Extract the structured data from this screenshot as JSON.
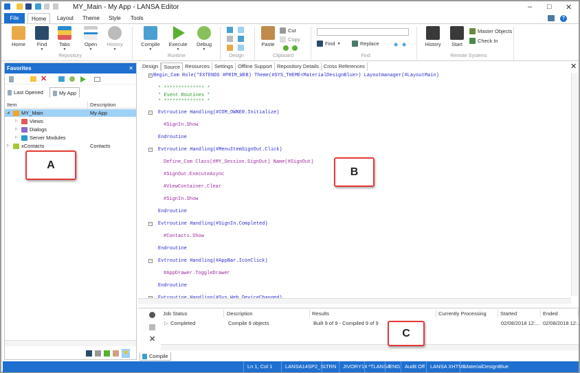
{
  "window": {
    "title": "MY_Main - My App - LANSA Editor",
    "controls": [
      "minimize",
      "maximize",
      "close"
    ]
  },
  "menu": {
    "file": "File",
    "tabs": [
      "Home",
      "Layout",
      "Theme",
      "Style",
      "Tools"
    ]
  },
  "ribbon": {
    "repository": {
      "label": "Repository",
      "buttons": [
        "Home",
        "Find",
        "Tabs",
        "Open",
        "History"
      ]
    },
    "runtime": {
      "label": "Runtime",
      "buttons": [
        "Compile",
        "Execute",
        "Debug"
      ]
    },
    "design": {
      "label": "Design"
    },
    "clipboard": {
      "label": "Clipboard",
      "paste": "Paste",
      "cut": "Cut",
      "copy": "Copy"
    },
    "find": {
      "label": "Find",
      "find": "Find",
      "replace": "Replace",
      "input_value": ""
    },
    "remote": {
      "label": "Remote Systems",
      "history": "History",
      "start": "Start",
      "master": "Master Objects",
      "checkin": "Check In"
    }
  },
  "favorites": {
    "title": "Favorites",
    "tabs": [
      "Last Opened",
      "My App"
    ],
    "columns": [
      "Item",
      "Description"
    ],
    "rows": [
      {
        "item": "MY_Main",
        "desc": "My App",
        "level": 0,
        "selected": true,
        "expanded": true,
        "color": "#f5a623"
      },
      {
        "item": "Views",
        "desc": "",
        "level": 1,
        "color": "#e05a5a"
      },
      {
        "item": "Dialogs",
        "desc": "",
        "level": 1,
        "color": "#8a6ad0"
      },
      {
        "item": "Server Modules",
        "desc": "",
        "level": 1,
        "color": "#2a9ad0"
      },
      {
        "item": "xContacts",
        "desc": "Contacts",
        "level": 0,
        "color": "#a5c83a"
      }
    ]
  },
  "editor": {
    "tabs": [
      "Design",
      "Source",
      "Resources",
      "Settings",
      "Offline Support",
      "Repository Details",
      "Cross References"
    ],
    "active_tab": "Source",
    "lines": [
      {
        "t": "Begin_Com Role(*EXTENDS #PRIM_WEB) Theme(#SYS_THEME<MaterialDesignBlue>) Layoutmanager(#LayoutMain)",
        "k": "com",
        "lv": 0,
        "exp": "+"
      },
      {
        "t": "* ************** *",
        "k": "cmt",
        "lv": 1
      },
      {
        "t": "* Event Routines *",
        "k": "cmt",
        "lv": 1
      },
      {
        "t": "* ************** *",
        "k": "cmt",
        "lv": 1
      },
      {
        "t": "Evtroutine Handling(#COM_OWNER.Initialize)",
        "k": "kw",
        "lv": 1,
        "exp": "-"
      },
      {
        "t": "#SignIn.Show",
        "k": "st",
        "lv": 2
      },
      {
        "t": "Endroutine",
        "k": "kw",
        "lv": 1
      },
      {
        "t": "Evtroutine Handling(#MenuItemSignOut.Click)",
        "k": "kw",
        "lv": 1,
        "exp": "-"
      },
      {
        "t": "Define_Com Class(#MY_Session.SignOut) Name(#SignOut)",
        "k": "st",
        "lv": 2
      },
      {
        "t": "#SignOut.ExecuteAsync",
        "k": "st",
        "lv": 2
      },
      {
        "t": "#ViewContainer.Clear",
        "k": "st",
        "lv": 2
      },
      {
        "t": "#SignIn.Show",
        "k": "st",
        "lv": 2
      },
      {
        "t": "Endroutine",
        "k": "kw",
        "lv": 1
      },
      {
        "t": "Evtroutine Handling(#SignIn.Completed)",
        "k": "kw",
        "lv": 1,
        "exp": "-"
      },
      {
        "t": "#Contacts.Show",
        "k": "st",
        "lv": 2
      },
      {
        "t": "Endroutine",
        "k": "kw",
        "lv": 1
      },
      {
        "t": "Evtroutine Handling(#AppBar.IconClick)",
        "k": "kw",
        "lv": 1,
        "exp": "-"
      },
      {
        "t": "#AppDrawer.ToggleDrawer",
        "k": "st",
        "lv": 2
      },
      {
        "t": "Endroutine",
        "k": "kw",
        "lv": 1
      },
      {
        "t": "Evtroutine Handling(#Sys_Web.DeviceChanged)",
        "k": "kw",
        "lv": 1,
        "exp": "-"
      }
    ]
  },
  "output": {
    "columns": [
      "Job Status",
      "Description",
      "Results",
      "Currently Processing",
      "Started",
      "Ended"
    ],
    "row": {
      "status": "Completed",
      "description": "Compile 9 objects",
      "results": "Built 9 of 9 - Compiled 9 of 9",
      "processing": "",
      "started": "02/08/2018 12:...",
      "ended": "02/08/2018 12:..."
    },
    "tab": "Compile"
  },
  "status": [
    "Ln 1, Col 1",
    "LANSA14SP2_SL",
    "TRN",
    "JIVORY14",
    "*TLANSA",
    "ENG",
    "Audit Off",
    "LANSA XHTML",
    "MaterialDesignBlue"
  ],
  "callouts": {
    "a": "A",
    "b": "B",
    "c": "C"
  },
  "colors": {
    "accent": "#1e6fd0",
    "callout_border": "#e53935",
    "selection": "#9fd0f5"
  }
}
